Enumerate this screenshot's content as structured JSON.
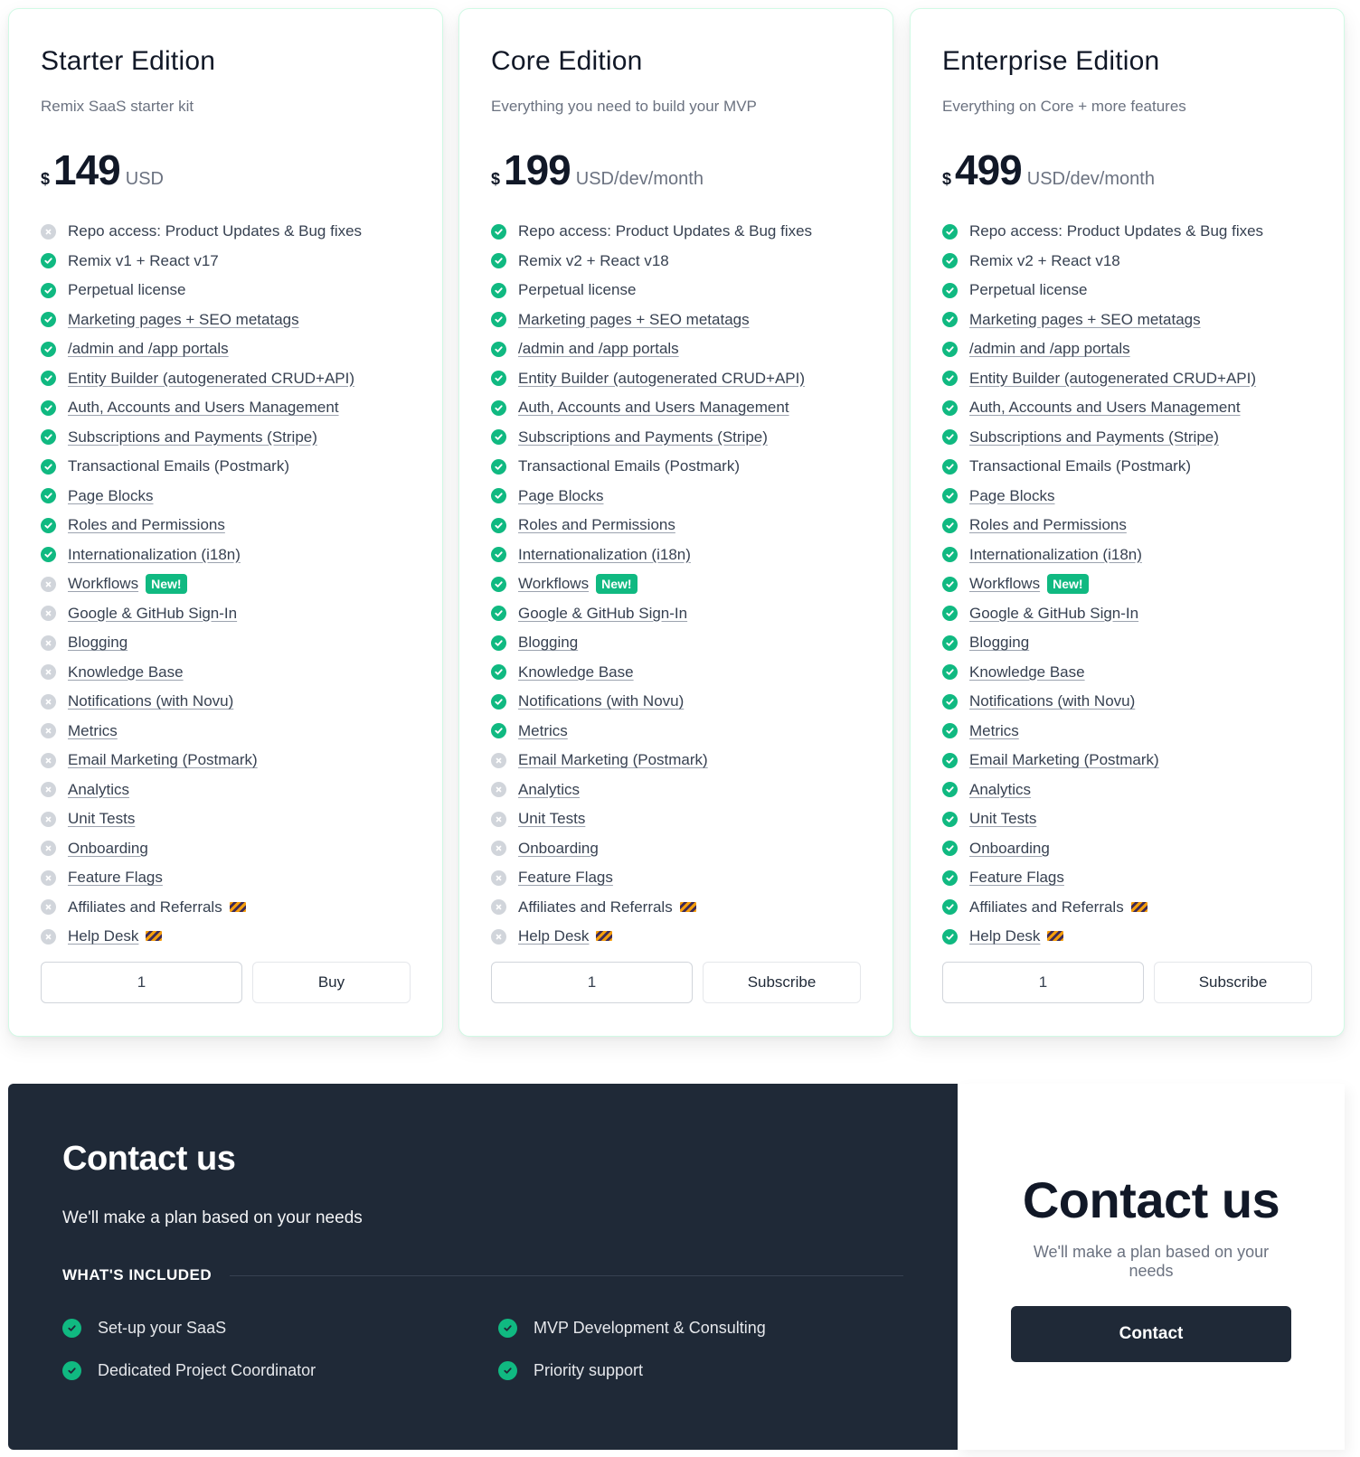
{
  "colors": {
    "accent": "#10b981",
    "disabled": "#d1d5db",
    "dark": "#1f2937"
  },
  "plans": [
    {
      "title": "Starter Edition",
      "subtitle": "Remix SaaS starter kit",
      "currency": "$",
      "amount": "149",
      "period": "USD",
      "quantity": "1",
      "action": "Buy",
      "features": [
        {
          "label": "Repo access: Product Updates & Bug fixes",
          "included": false,
          "link": false
        },
        {
          "label": "Remix v1 + React v17",
          "included": true,
          "link": false
        },
        {
          "label": "Perpetual license",
          "included": true,
          "link": false
        },
        {
          "label": "Marketing pages + SEO metatags",
          "included": true,
          "link": true
        },
        {
          "label": "/admin and /app portals",
          "included": true,
          "link": true
        },
        {
          "label": "Entity Builder (autogenerated CRUD+API)",
          "included": true,
          "link": true
        },
        {
          "label": "Auth, Accounts and Users Management",
          "included": true,
          "link": true
        },
        {
          "label": "Subscriptions and Payments (Stripe)",
          "included": true,
          "link": true
        },
        {
          "label": "Transactional Emails (Postmark)",
          "included": true,
          "link": false
        },
        {
          "label": "Page Blocks",
          "included": true,
          "link": true
        },
        {
          "label": "Roles and Permissions",
          "included": true,
          "link": true
        },
        {
          "label": "Internationalization (i18n)",
          "included": true,
          "link": true
        },
        {
          "label": "Workflows",
          "included": false,
          "link": true,
          "badge": "New!"
        },
        {
          "label": "Google & GitHub Sign-In",
          "included": false,
          "link": true
        },
        {
          "label": "Blogging",
          "included": false,
          "link": true
        },
        {
          "label": "Knowledge Base",
          "included": false,
          "link": true
        },
        {
          "label": "Notifications (with Novu)",
          "included": false,
          "link": true
        },
        {
          "label": "Metrics",
          "included": false,
          "link": true
        },
        {
          "label": "Email Marketing (Postmark)",
          "included": false,
          "link": true
        },
        {
          "label": "Analytics",
          "included": false,
          "link": true
        },
        {
          "label": "Unit Tests",
          "included": false,
          "link": true
        },
        {
          "label": "Onboarding",
          "included": false,
          "link": true
        },
        {
          "label": "Feature Flags",
          "included": false,
          "link": true
        },
        {
          "label": "Affiliates and Referrals",
          "included": false,
          "link": false,
          "wip": true
        },
        {
          "label": "Help Desk",
          "included": false,
          "link": true,
          "wip": true
        }
      ]
    },
    {
      "title": "Core Edition",
      "subtitle": "Everything you need to build your MVP",
      "currency": "$",
      "amount": "199",
      "period": "USD/dev/month",
      "quantity": "1",
      "action": "Subscribe",
      "features": [
        {
          "label": "Repo access: Product Updates & Bug fixes",
          "included": true,
          "link": false
        },
        {
          "label": "Remix v2 + React v18",
          "included": true,
          "link": false
        },
        {
          "label": "Perpetual license",
          "included": true,
          "link": false
        },
        {
          "label": "Marketing pages + SEO metatags",
          "included": true,
          "link": true
        },
        {
          "label": "/admin and /app portals",
          "included": true,
          "link": true
        },
        {
          "label": "Entity Builder (autogenerated CRUD+API)",
          "included": true,
          "link": true
        },
        {
          "label": "Auth, Accounts and Users Management",
          "included": true,
          "link": true
        },
        {
          "label": "Subscriptions and Payments (Stripe)",
          "included": true,
          "link": true
        },
        {
          "label": "Transactional Emails (Postmark)",
          "included": true,
          "link": false
        },
        {
          "label": "Page Blocks",
          "included": true,
          "link": true
        },
        {
          "label": "Roles and Permissions",
          "included": true,
          "link": true
        },
        {
          "label": "Internationalization (i18n)",
          "included": true,
          "link": true
        },
        {
          "label": "Workflows",
          "included": true,
          "link": true,
          "badge": "New!"
        },
        {
          "label": "Google & GitHub Sign-In",
          "included": true,
          "link": true
        },
        {
          "label": "Blogging",
          "included": true,
          "link": true
        },
        {
          "label": "Knowledge Base",
          "included": true,
          "link": true
        },
        {
          "label": "Notifications (with Novu)",
          "included": true,
          "link": true
        },
        {
          "label": "Metrics",
          "included": true,
          "link": true
        },
        {
          "label": "Email Marketing (Postmark)",
          "included": false,
          "link": true
        },
        {
          "label": "Analytics",
          "included": false,
          "link": true
        },
        {
          "label": "Unit Tests",
          "included": false,
          "link": true
        },
        {
          "label": "Onboarding",
          "included": false,
          "link": true
        },
        {
          "label": "Feature Flags",
          "included": false,
          "link": true
        },
        {
          "label": "Affiliates and Referrals",
          "included": false,
          "link": false,
          "wip": true
        },
        {
          "label": "Help Desk",
          "included": false,
          "link": true,
          "wip": true
        }
      ]
    },
    {
      "title": "Enterprise Edition",
      "subtitle": "Everything on Core + more features",
      "currency": "$",
      "amount": "499",
      "period": "USD/dev/month",
      "quantity": "1",
      "action": "Subscribe",
      "features": [
        {
          "label": "Repo access: Product Updates & Bug fixes",
          "included": true,
          "link": false
        },
        {
          "label": "Remix v2 + React v18",
          "included": true,
          "link": false
        },
        {
          "label": "Perpetual license",
          "included": true,
          "link": false
        },
        {
          "label": "Marketing pages + SEO metatags",
          "included": true,
          "link": true
        },
        {
          "label": "/admin and /app portals",
          "included": true,
          "link": true
        },
        {
          "label": "Entity Builder (autogenerated CRUD+API)",
          "included": true,
          "link": true
        },
        {
          "label": "Auth, Accounts and Users Management",
          "included": true,
          "link": true
        },
        {
          "label": "Subscriptions and Payments (Stripe)",
          "included": true,
          "link": true
        },
        {
          "label": "Transactional Emails (Postmark)",
          "included": true,
          "link": false
        },
        {
          "label": "Page Blocks",
          "included": true,
          "link": true
        },
        {
          "label": "Roles and Permissions",
          "included": true,
          "link": true
        },
        {
          "label": "Internationalization (i18n)",
          "included": true,
          "link": true
        },
        {
          "label": "Workflows",
          "included": true,
          "link": true,
          "badge": "New!"
        },
        {
          "label": "Google & GitHub Sign-In",
          "included": true,
          "link": true
        },
        {
          "label": "Blogging",
          "included": true,
          "link": true
        },
        {
          "label": "Knowledge Base",
          "included": true,
          "link": true
        },
        {
          "label": "Notifications (with Novu)",
          "included": true,
          "link": true
        },
        {
          "label": "Metrics",
          "included": true,
          "link": true
        },
        {
          "label": "Email Marketing (Postmark)",
          "included": true,
          "link": true
        },
        {
          "label": "Analytics",
          "included": true,
          "link": true
        },
        {
          "label": "Unit Tests",
          "included": true,
          "link": true
        },
        {
          "label": "Onboarding",
          "included": true,
          "link": true
        },
        {
          "label": "Feature Flags",
          "included": true,
          "link": true
        },
        {
          "label": "Affiliates and Referrals",
          "included": true,
          "link": false,
          "wip": true
        },
        {
          "label": "Help Desk",
          "included": true,
          "link": true,
          "wip": true
        }
      ]
    }
  ],
  "contact_dark": {
    "title": "Contact us",
    "subtitle": "We'll make a plan based on your needs",
    "included_label": "WHAT'S INCLUDED",
    "items": [
      "Set-up your SaaS",
      "MVP Development & Consulting",
      "Dedicated Project Coordinator",
      "Priority support"
    ]
  },
  "contact_light": {
    "title": "Contact us",
    "subtitle": "We'll make a plan based on your needs",
    "button": "Contact"
  }
}
